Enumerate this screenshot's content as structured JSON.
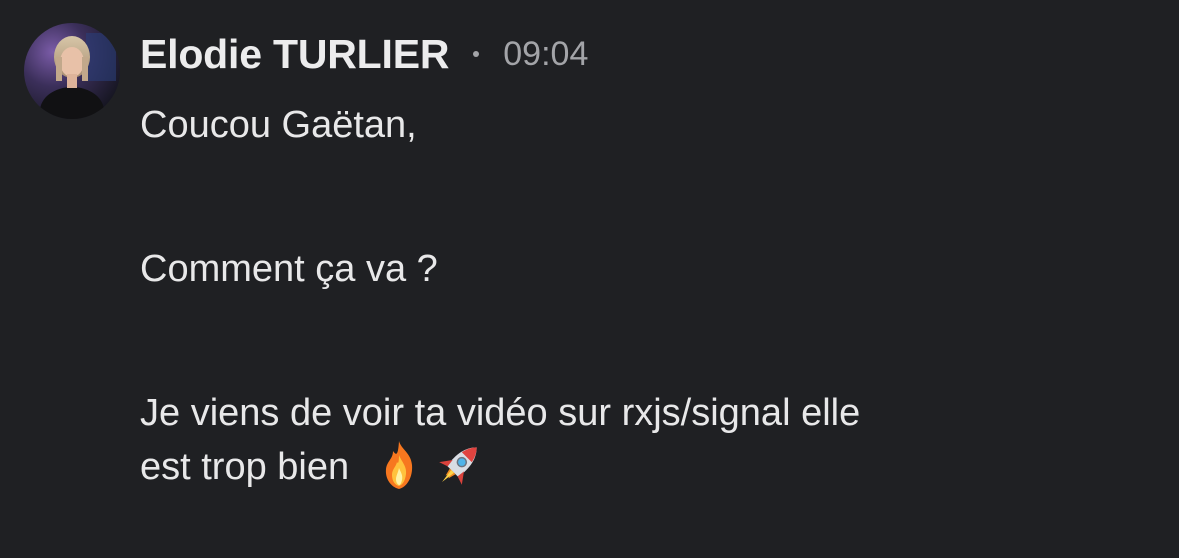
{
  "message": {
    "author": "Elodie TURLIER",
    "time": "09:04",
    "lines": [
      "Coucou Gaëtan,",
      "Comment ça va ?",
      "Je viens de voir ta vidéo sur rxjs/signal elle",
      "est trop bien"
    ],
    "emojis": [
      "fire-icon",
      "rocket-icon"
    ]
  },
  "colors": {
    "background": "#1f2023",
    "text": "#e8e8e9",
    "muted": "#a3a4a8"
  }
}
